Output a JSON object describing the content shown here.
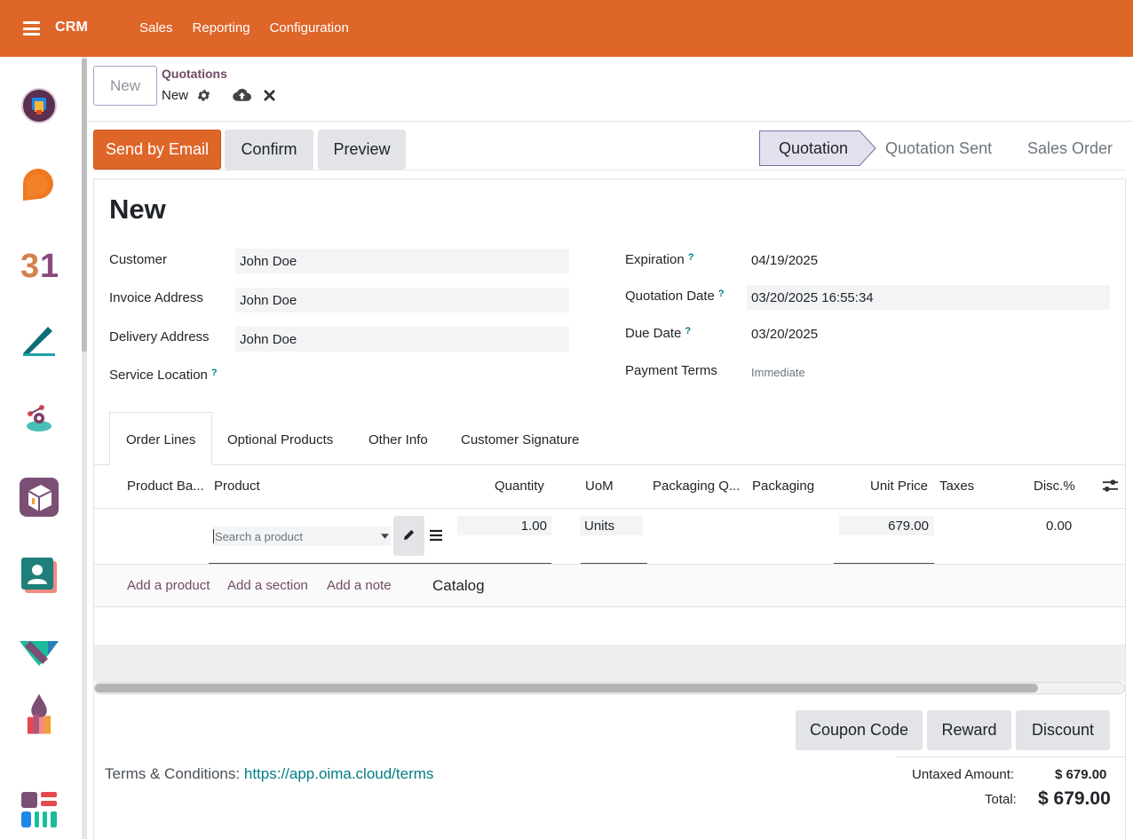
{
  "topbar": {
    "app_name": "CRM",
    "menu": [
      "Sales",
      "Reporting",
      "Configuration"
    ]
  },
  "sidebar": {
    "apps": [
      "discuss-app-icon",
      "chat-bubble-app-icon",
      "calendar-app-icon",
      "sign-app-icon",
      "field-service-app-icon",
      "inventory-app-icon",
      "employees-app-icon",
      "crm-app-icon",
      "spreadsheet-app-icon",
      "apps-grid-icon"
    ]
  },
  "control": {
    "new_label": "New",
    "breadcrumb": "Quotations",
    "record": "New"
  },
  "actions": {
    "send_email": "Send by Email",
    "confirm": "Confirm",
    "preview": "Preview"
  },
  "status": {
    "items": [
      "Quotation",
      "Quotation Sent",
      "Sales Order"
    ],
    "active": "Quotation"
  },
  "form": {
    "title": "New",
    "left": {
      "customer_label": "Customer",
      "customer_value": "John Doe",
      "invoice_label": "Invoice Address",
      "invoice_value": "John Doe",
      "delivery_label": "Delivery Address",
      "delivery_value": "John Doe",
      "service_label": "Service Location"
    },
    "right": {
      "expiration_label": "Expiration",
      "expiration_value": "04/19/2025",
      "quotation_date_label": "Quotation Date",
      "quotation_date_value": "03/20/2025 16:55:34",
      "due_date_label": "Due Date",
      "due_date_value": "03/20/2025",
      "payment_terms_label": "Payment Terms",
      "payment_terms_placeholder": "Immediate"
    },
    "help_mark": "?"
  },
  "tabs": [
    "Order Lines",
    "Optional Products",
    "Other Info",
    "Customer Signature"
  ],
  "table": {
    "headers": {
      "barcode": "Product Ba...",
      "product": "Product",
      "quantity": "Quantity",
      "uom": "UoM",
      "packaging_qty": "Packaging Q...",
      "packaging": "Packaging",
      "unit_price": "Unit Price",
      "taxes": "Taxes",
      "discount": "Disc.%"
    },
    "row": {
      "product_placeholder": "Search a product",
      "quantity": "1.00",
      "uom": "Units",
      "unit_price": "679.00",
      "discount": "0.00"
    },
    "add_product": "Add a product",
    "add_section": "Add a section",
    "add_note": "Add a note",
    "catalog": "Catalog"
  },
  "footer": {
    "coupon": "Coupon Code",
    "reward": "Reward",
    "discount": "Discount",
    "terms_label": "Terms & Conditions:",
    "terms_link": "https://app.oima.cloud/terms",
    "untaxed_label": "Untaxed Amount:",
    "untaxed_value": "$ 679.00",
    "total_label": "Total:",
    "total_value": "$ 679.00"
  }
}
